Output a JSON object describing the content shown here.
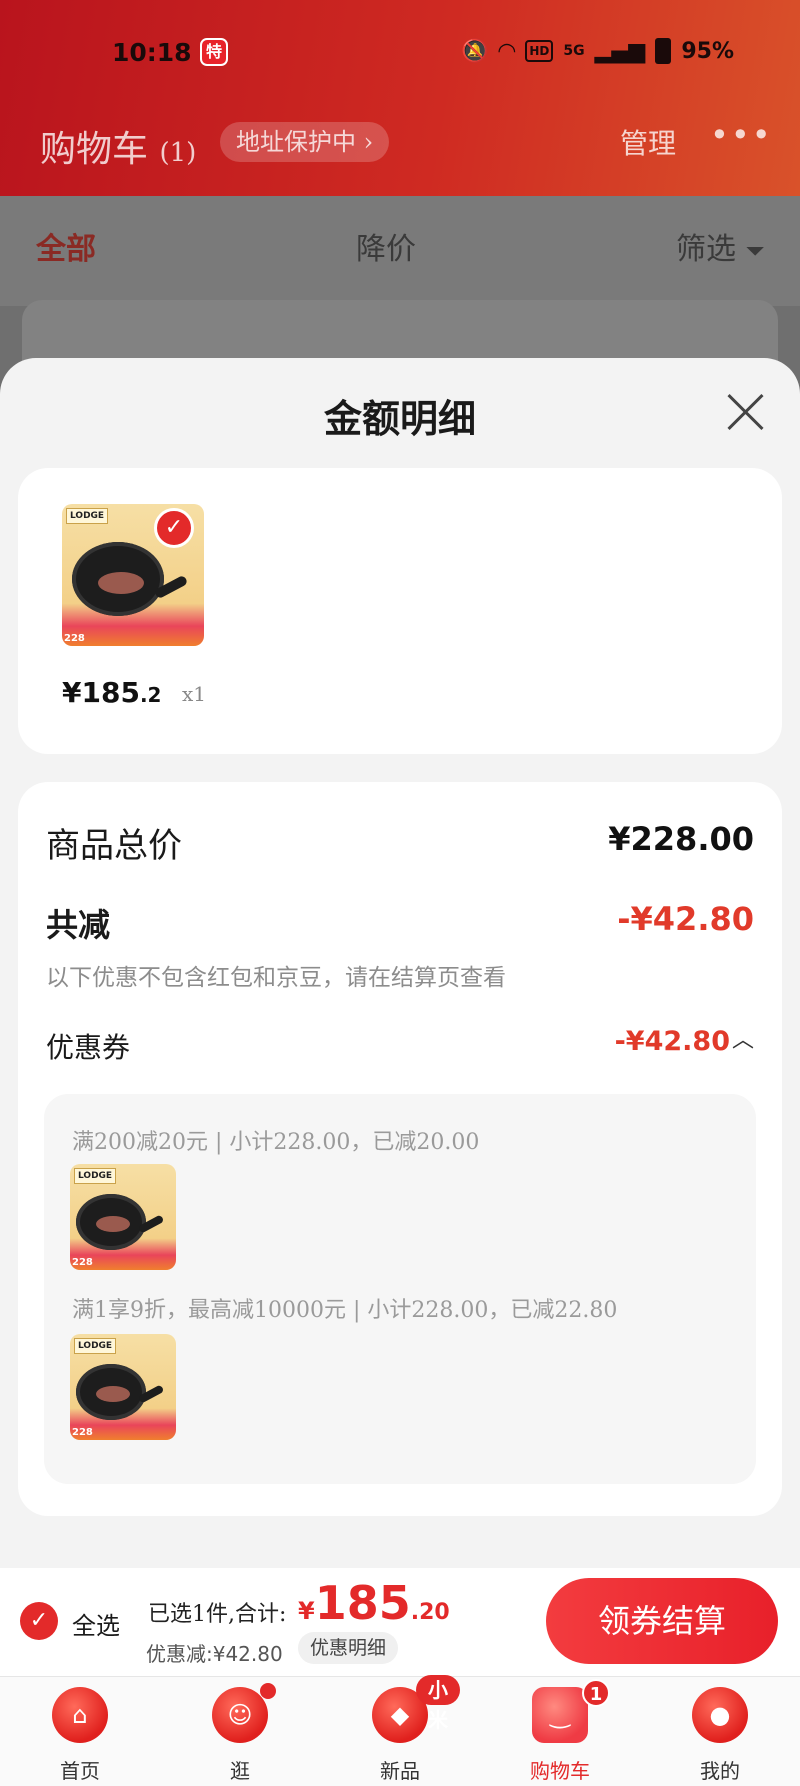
{
  "status_bar": {
    "time": "10:18",
    "app_badge": "特",
    "network": "5G",
    "hd": "HD",
    "battery": "95%"
  },
  "header": {
    "title": "购物车",
    "count": "(1)",
    "address_pill": "地址保护中 ›",
    "manage": "管理",
    "more": "•••"
  },
  "tabs": [
    {
      "label": "全部",
      "active": true
    },
    {
      "label": "降价",
      "active": false
    },
    {
      "label": "筛选",
      "active": false
    }
  ],
  "sheet": {
    "title": "金额明细",
    "item": {
      "price_int": "¥185",
      "price_dec": ".2",
      "qty": "x1",
      "thumb_brand": "LODGE",
      "thumb_price": "228"
    },
    "summary": {
      "total_label": "商品总价",
      "total_value": "¥228.00",
      "reduce_label": "共减",
      "reduce_value": "-¥42.80",
      "note": "以下优惠不包含红包和京豆，请在结算页查看",
      "coupon_label": "优惠券",
      "coupon_value": "-¥42.80"
    },
    "coupons": [
      "满200减20元 | 小计228.00，已减20.00",
      "满1享9折，最高减10000元 | 小计228.00，已减22.80"
    ]
  },
  "checkout": {
    "select_all": "全选",
    "selected_text": "已选1件,合计:",
    "price_symbol": "¥",
    "price_int": "185",
    "price_dec": ".20",
    "discount_text": "优惠减:¥42.80",
    "detail_link": "优惠明细",
    "button": "领券结算"
  },
  "bottom_nav": [
    {
      "label": "首页",
      "icon": "home-icon"
    },
    {
      "label": "逛",
      "icon": "browse-icon",
      "dot": true
    },
    {
      "label": "新品",
      "icon": "new-icon",
      "badge": "小米"
    },
    {
      "label": "购物车",
      "icon": "cart-icon",
      "count": "1",
      "active": true
    },
    {
      "label": "我的",
      "icon": "profile-icon"
    }
  ],
  "colors": {
    "accent": "#e32a2a",
    "header_start": "#b9141d",
    "header_end": "#d9522a",
    "sheet_bg": "#f3f3f3"
  }
}
